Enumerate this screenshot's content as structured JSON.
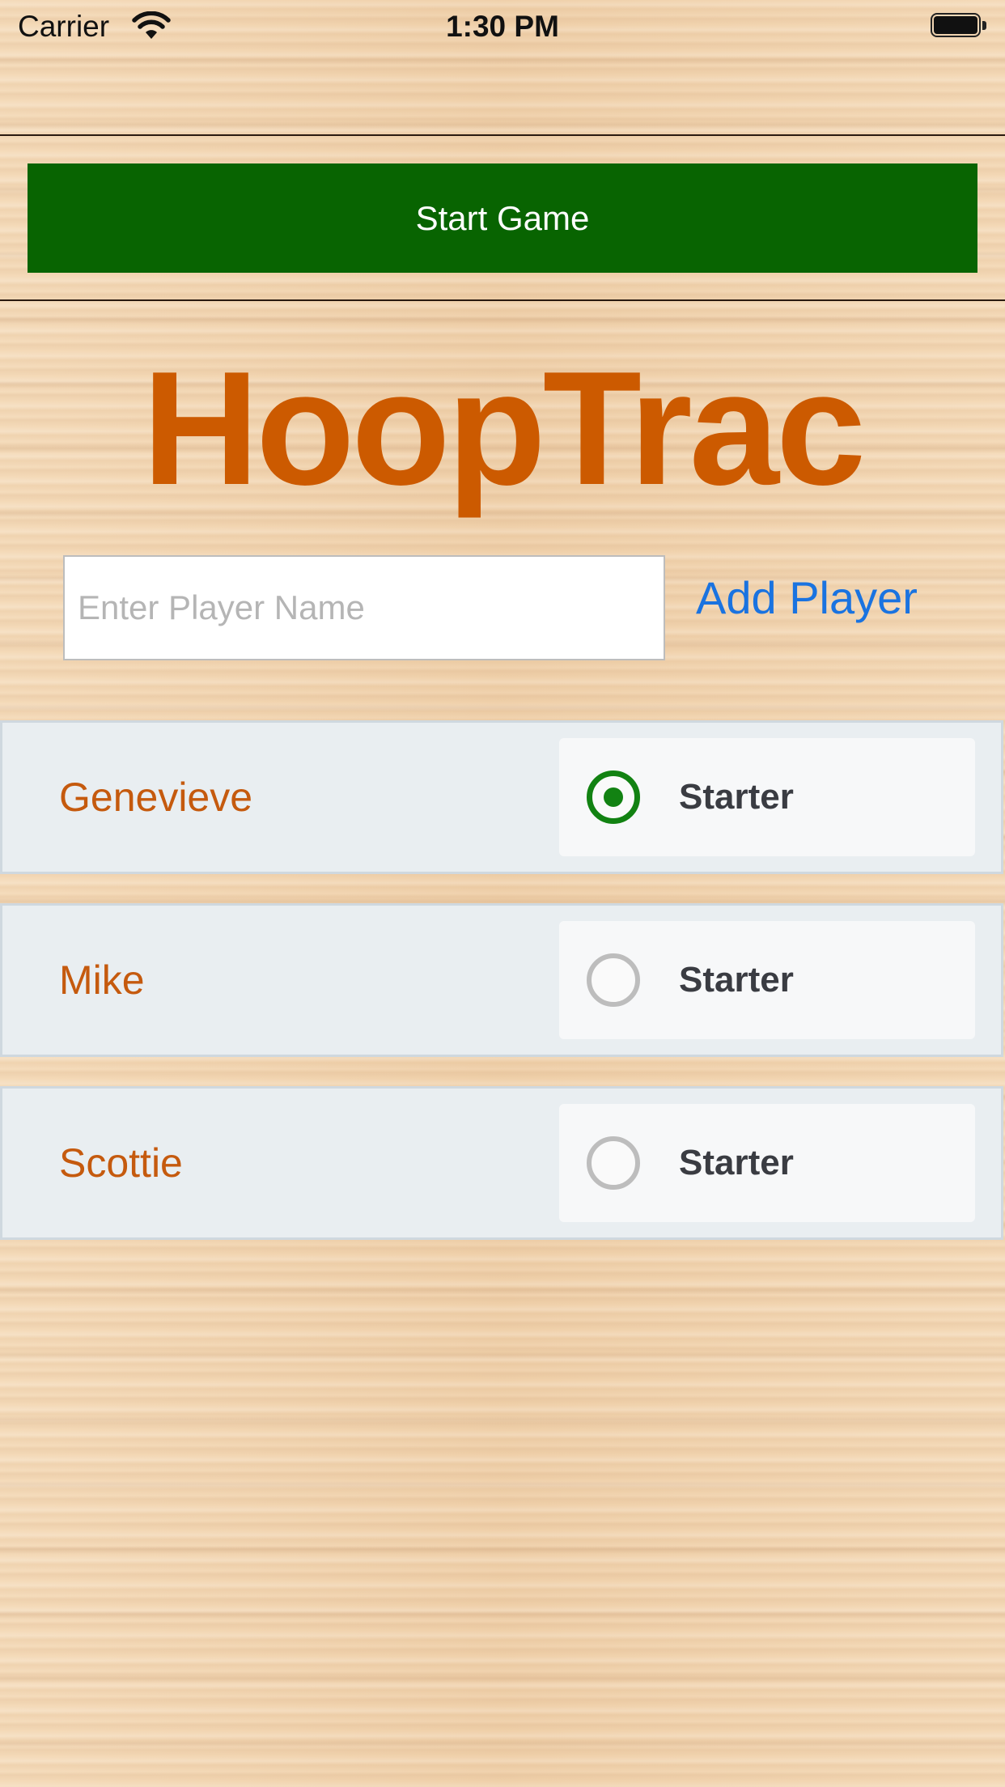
{
  "status_bar": {
    "carrier": "Carrier",
    "time": "1:30 PM"
  },
  "toolbar": {
    "start_label": "Start Game",
    "start_color": "#086401"
  },
  "app": {
    "title": "HoopTrac",
    "title_color": "#cc5a00"
  },
  "player_form": {
    "placeholder": "Enter Player Name",
    "value": "",
    "add_label": "Add Player"
  },
  "players": [
    {
      "name": "Genevieve",
      "starter_label": "Starter",
      "starter": true
    },
    {
      "name": "Mike",
      "starter_label": "Starter",
      "starter": false
    },
    {
      "name": "Scottie",
      "starter_label": "Starter",
      "starter": false
    }
  ],
  "colors": {
    "checked": "#128212",
    "unchecked": "#bdbdbd",
    "link": "#1a73e0",
    "player_name": "#c55a0e"
  }
}
